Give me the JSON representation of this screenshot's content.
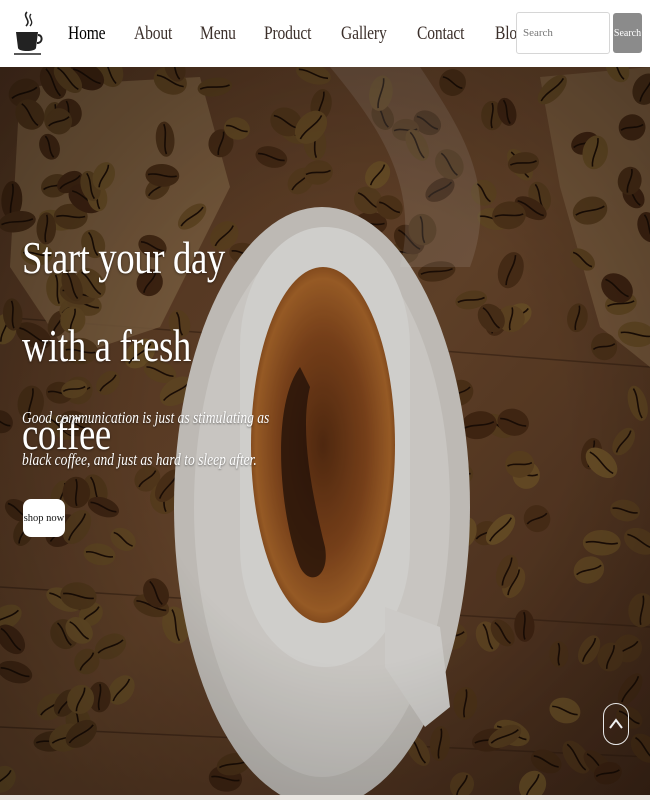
{
  "nav": {
    "logo_icon": "coffee-cup-logo-icon",
    "items": [
      {
        "label": "Home",
        "active": true
      },
      {
        "label": "About"
      },
      {
        "label": "Menu"
      },
      {
        "label": "Product"
      },
      {
        "label": "Gallery"
      },
      {
        "label": "Contact"
      },
      {
        "label": "Blogs"
      }
    ],
    "search": {
      "placeholder": "Search",
      "button_label": "Search"
    }
  },
  "hero": {
    "title": "Start your day with a fresh coffee",
    "subtitle": "Good communication is just as stimulating as black coffee, and just as hard to sleep after.",
    "button_label": "shop now",
    "scroll_icon": "chevron-up-icon"
  },
  "colors": {
    "nav_text": "#3b2f2a",
    "search_button": "#8b8b8b",
    "hero_text": "#ffffff"
  }
}
